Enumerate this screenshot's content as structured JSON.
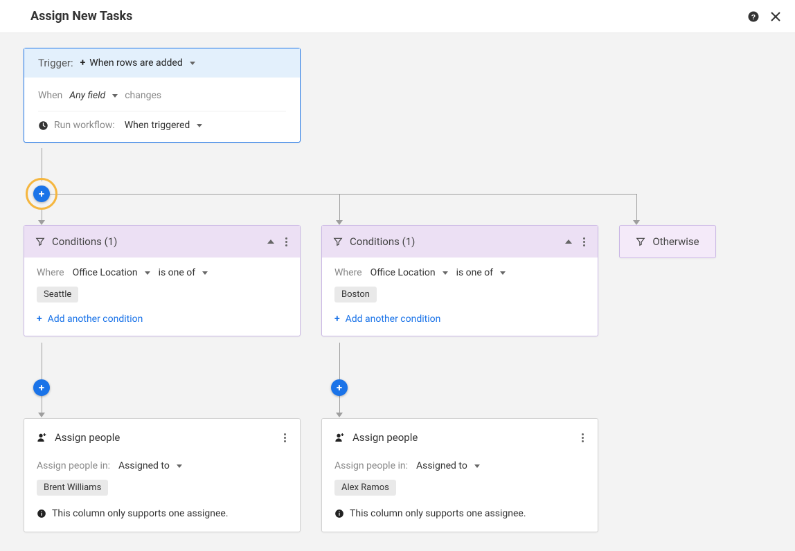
{
  "header": {
    "title": "Assign New Tasks"
  },
  "trigger": {
    "label": "Trigger:",
    "type": "When rows are added",
    "when_label": "When",
    "field": "Any field",
    "changes_label": "changes",
    "run_label": "Run workflow:",
    "run_value": "When triggered"
  },
  "branches": [
    {
      "title": "Conditions (1)",
      "where_label": "Where",
      "field": "Office Location",
      "operator": "is one of",
      "value": "Seattle",
      "add_label": "Add another condition",
      "assign": {
        "title": "Assign people",
        "label": "Assign people in:",
        "column": "Assigned to",
        "person": "Brent Williams",
        "info": "This column only supports one assignee."
      }
    },
    {
      "title": "Conditions (1)",
      "where_label": "Where",
      "field": "Office Location",
      "operator": "is one of",
      "value": "Boston",
      "add_label": "Add another condition",
      "assign": {
        "title": "Assign people",
        "label": "Assign people in:",
        "column": "Assigned to",
        "person": "Alex Ramos",
        "info": "This column only supports one assignee."
      }
    }
  ],
  "otherwise": {
    "label": "Otherwise"
  }
}
